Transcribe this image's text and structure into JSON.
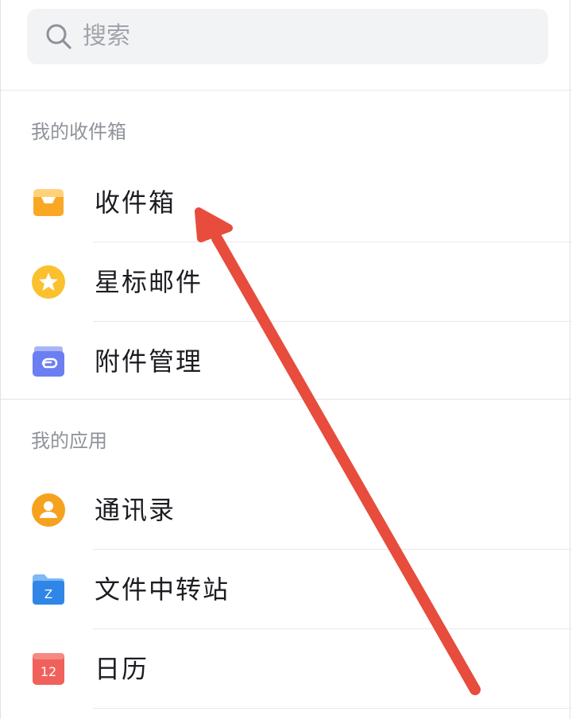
{
  "search": {
    "placeholder": "搜索"
  },
  "sections": [
    {
      "title": "我的收件箱",
      "items": [
        {
          "label": "收件箱",
          "icon": "inbox-icon",
          "color": "#f9a825"
        },
        {
          "label": "星标邮件",
          "icon": "star-icon",
          "color": "#fbc02d"
        },
        {
          "label": "附件管理",
          "icon": "attachment-icon",
          "color": "#6b7ef2"
        }
      ]
    },
    {
      "title": "我的应用",
      "items": [
        {
          "label": "通讯录",
          "icon": "contacts-icon",
          "color": "#f6a21e"
        },
        {
          "label": "文件中转站",
          "icon": "file-transfer-icon",
          "color": "#2f86e8",
          "glyph": "Z"
        },
        {
          "label": "日历",
          "icon": "calendar-icon",
          "color": "#f0615b",
          "glyph": "12"
        }
      ]
    }
  ],
  "annotation": {
    "type": "arrow",
    "color": "#e74c3c"
  }
}
